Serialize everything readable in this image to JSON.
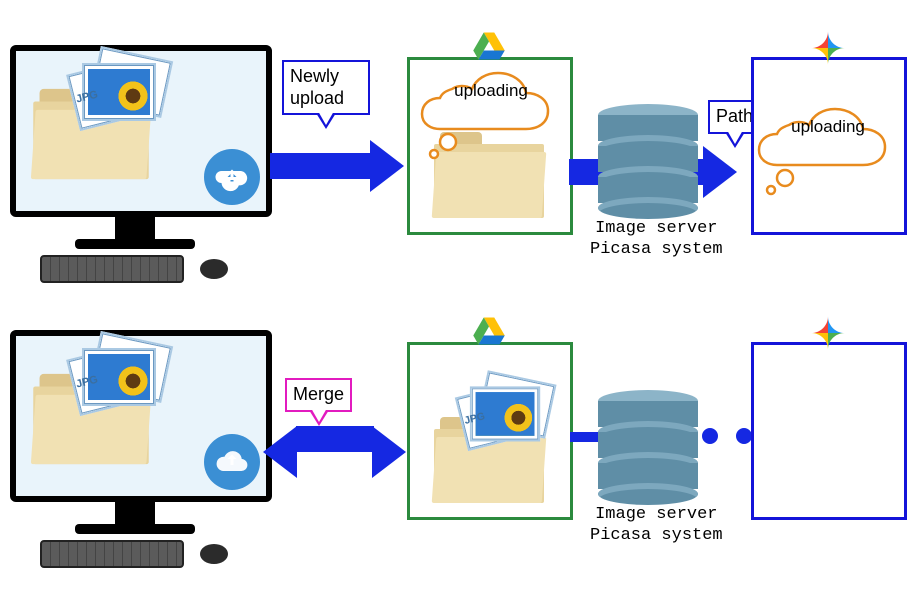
{
  "labels": {
    "newly_upload": "Newly\nupload",
    "path": "Path",
    "merge": "Merge",
    "uploading": "uploading"
  },
  "image_server": {
    "line1": "Image server",
    "line2": "Picasa system"
  },
  "icons": {
    "drive": "google-drive-icon",
    "photos": "google-photos-icon",
    "cloud_upload": "cloud-upload-icon",
    "folder": "folder-icon",
    "database": "database-icon",
    "photo_jpg": "jpg-photo-icon",
    "computer": "desktop-computer-icon",
    "keyboard": "keyboard-icon",
    "mouse": "mouse-icon",
    "thought": "thought-bubble-icon"
  },
  "colors": {
    "blue": "#1528e2",
    "green_box": "#2b8a3e",
    "magenta": "#e21bbf",
    "cloud_orange": "#e88b1e",
    "db": "#5f8ea6"
  },
  "jpg_label": "JPG"
}
